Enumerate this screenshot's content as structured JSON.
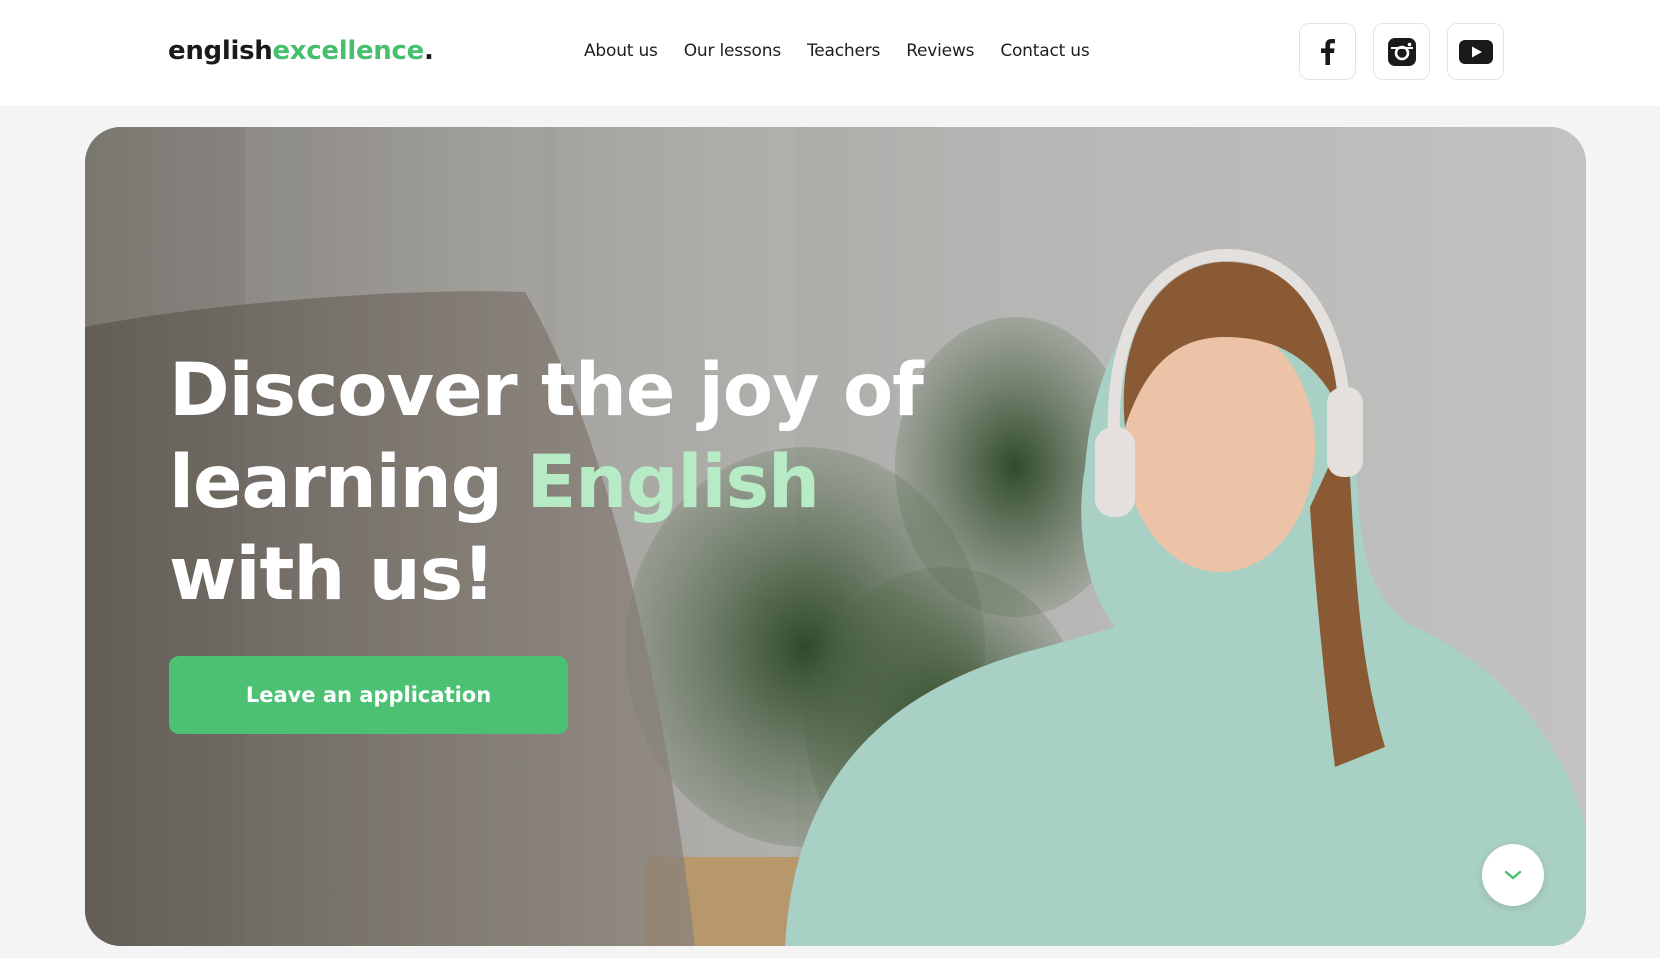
{
  "header": {
    "logo": {
      "part1": "english",
      "part2": "excellence",
      "dot": "."
    },
    "nav": [
      "About us",
      "Our lessons",
      "Teachers",
      "Reviews",
      "Contact us"
    ],
    "socials": [
      {
        "icon": "facebook-icon"
      },
      {
        "icon": "instagram-icon"
      },
      {
        "icon": "youtube-icon"
      }
    ]
  },
  "hero": {
    "title": {
      "line1": "Discover the joy of",
      "line2a": "learning ",
      "highlight": "English",
      "line3": "with us!"
    },
    "cta": "Leave an application",
    "scroll_icon": "chevron-down-icon"
  },
  "colors": {
    "accent": "#47bf6e",
    "button": "#4cc073",
    "highlight": "#b6ebc6"
  }
}
